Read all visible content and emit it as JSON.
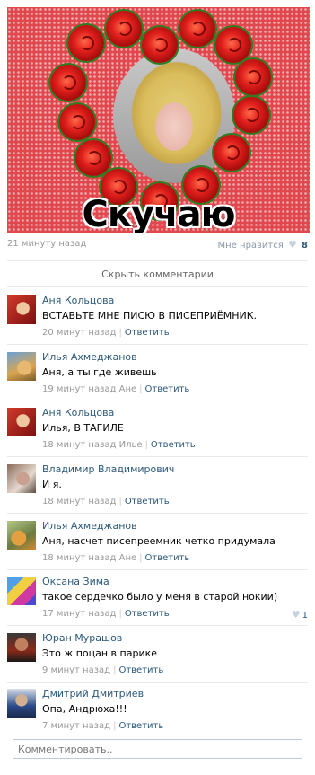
{
  "post": {
    "caption": "Скучаю",
    "time": "21 минуту назад",
    "like_label": "Мне нравится",
    "like_count": "8"
  },
  "hide_comments": "Скрыть комментарии",
  "comments": [
    {
      "name": "Аня Кольцова",
      "text": "ВСТАВЬТЕ МНЕ ПИСЮ В ПИСЕПРИЁМНИК.",
      "time": "20 минут назад",
      "reply": "Ответить",
      "likes": ""
    },
    {
      "name": "Илья Ахмеджанов",
      "text": "Аня, а ты где живешь",
      "time": "19 минут назад Ане",
      "reply": "Ответить",
      "likes": ""
    },
    {
      "name": "Аня Кольцова",
      "text": "Илья, В ТАГИЛЕ",
      "time": "18 минут назад Илье",
      "reply": "Ответить",
      "likes": ""
    },
    {
      "name": "Владимир Владимирович",
      "text": "И я.",
      "time": "18 минут назад",
      "reply": "Ответить",
      "likes": ""
    },
    {
      "name": "Илья Ахмеджанов",
      "text": "Аня, насчет писепреемник четко придумала",
      "time": "18 минут назад Ане",
      "reply": "Ответить",
      "likes": ""
    },
    {
      "name": "Оксана Зима",
      "text": "такое сердечко было у меня в старой нокии)",
      "time": "17 минут назад",
      "reply": "Ответить",
      "likes": "1"
    },
    {
      "name": "Юран Мурашов",
      "text": "Это ж поцан в парике",
      "time": "9 минут назад",
      "reply": "Ответить",
      "likes": ""
    },
    {
      "name": "Дмитрий Дмитриев",
      "text": "Опа, Андрюха!!!",
      "time": "7 минут назад",
      "reply": "Ответить",
      "likes": ""
    }
  ],
  "comment_input": {
    "placeholder": "Комментировать.."
  },
  "icons": {
    "like": "heart-icon"
  }
}
